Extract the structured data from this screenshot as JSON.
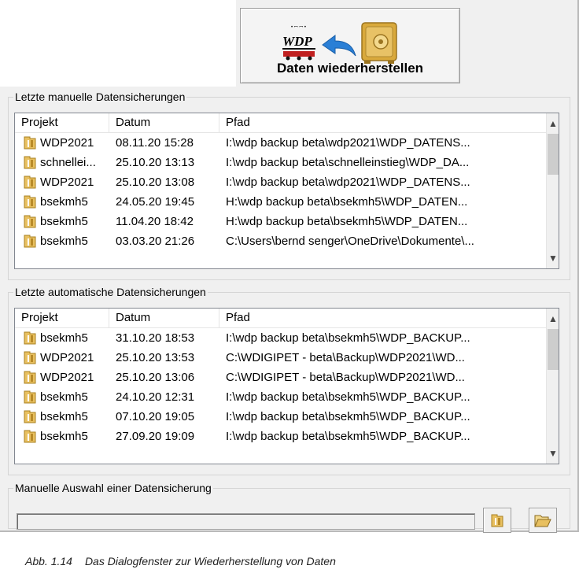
{
  "restore_button": {
    "label": "Daten wiederherstellen",
    "wdp_logo_text": "WDP"
  },
  "manual": {
    "group_title": "Letzte manuelle Datensicherungen",
    "columns": [
      "Projekt",
      "Datum",
      "Pfad"
    ],
    "rows": [
      {
        "projekt": "WDP2021",
        "datum": "08.11.20 15:28",
        "pfad": "I:\\wdp backup beta\\wdp2021\\WDP_DATENS..."
      },
      {
        "projekt": "schnellei...",
        "datum": "25.10.20 13:13",
        "pfad": "I:\\wdp backup beta\\schnelleinstieg\\WDP_DA..."
      },
      {
        "projekt": "WDP2021",
        "datum": "25.10.20 13:08",
        "pfad": "I:\\wdp backup beta\\wdp2021\\WDP_DATENS..."
      },
      {
        "projekt": "bsekmh5",
        "datum": "24.05.20 19:45",
        "pfad": "H:\\wdp backup beta\\bsekmh5\\WDP_DATEN..."
      },
      {
        "projekt": "bsekmh5",
        "datum": "11.04.20 18:42",
        "pfad": "H:\\wdp backup beta\\bsekmh5\\WDP_DATEN..."
      },
      {
        "projekt": "bsekmh5",
        "datum": "03.03.20 21:26",
        "pfad": "C:\\Users\\bernd senger\\OneDrive\\Dokumente\\..."
      }
    ]
  },
  "auto": {
    "group_title": "Letzte automatische Datensicherungen",
    "columns": [
      "Projekt",
      "Datum",
      "Pfad"
    ],
    "rows": [
      {
        "projekt": "bsekmh5",
        "datum": "31.10.20 18:53",
        "pfad": "I:\\wdp backup beta\\bsekmh5\\WDP_BACKUP..."
      },
      {
        "projekt": "WDP2021",
        "datum": "25.10.20 13:53",
        "pfad": "C:\\WDIGIPET - beta\\Backup\\WDP2021\\WD..."
      },
      {
        "projekt": "WDP2021",
        "datum": "25.10.20 13:06",
        "pfad": "C:\\WDIGIPET - beta\\Backup\\WDP2021\\WD..."
      },
      {
        "projekt": "bsekmh5",
        "datum": "24.10.20 12:31",
        "pfad": "I:\\wdp backup beta\\bsekmh5\\WDP_BACKUP..."
      },
      {
        "projekt": "bsekmh5",
        "datum": "07.10.20 19:05",
        "pfad": "I:\\wdp backup beta\\bsekmh5\\WDP_BACKUP..."
      },
      {
        "projekt": "bsekmh5",
        "datum": "27.09.20 19:09",
        "pfad": "I:\\wdp backup beta\\bsekmh5\\WDP_BACKUP..."
      }
    ]
  },
  "manual_select": {
    "group_title": "Manuelle Auswahl einer Datensicherung",
    "path_value": ""
  },
  "caption": {
    "number": "Abb. 1.14",
    "text": "Das Dialogfenster zur Wiederherstellung von Daten"
  },
  "icons": [
    "wdp-logo-icon",
    "back-arrow-icon",
    "safe-icon",
    "project-folder-icon",
    "open-folder-icon",
    "scroll-up-icon",
    "scroll-down-icon"
  ],
  "colors": {
    "dialog_bg": "#f0f0f0",
    "arrow_blue": "#2a7fd6",
    "safe_gold": "#d9a93c",
    "folder_gold": "#e8c060"
  }
}
